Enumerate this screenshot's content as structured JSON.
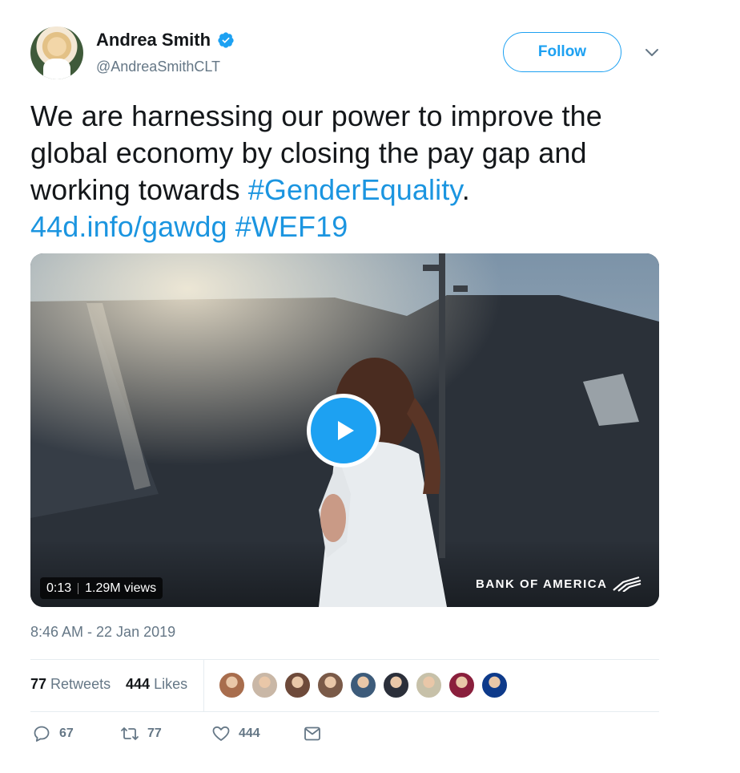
{
  "author": {
    "display_name": "Andrea Smith",
    "handle": "@AndreaSmithCLT"
  },
  "follow_label": "Follow",
  "tweet": {
    "text_plain": "We are harnessing our power to improve the global economy by closing the pay gap and working towards ",
    "hashtag1": "#GenderEquality",
    "period": ".",
    "link": "44d.info/gawdg",
    "hashtag2": "#WEF19"
  },
  "video": {
    "duration": "0:13",
    "views": "1.29M views",
    "brand": "BANK OF AMERICA"
  },
  "timestamp": "8:46 AM - 22 Jan 2019",
  "stats": {
    "retweets_count": "77",
    "retweets_label": "Retweets",
    "likes_count": "444",
    "likes_label": "Likes"
  },
  "likers": [
    {
      "icon": "liker-avatar",
      "color": "#a86d4d"
    },
    {
      "icon": "liker-avatar",
      "color": "#c9b7a6"
    },
    {
      "icon": "liker-avatar",
      "color": "#6e4a3a"
    },
    {
      "icon": "liker-avatar",
      "color": "#7a5a48"
    },
    {
      "icon": "liker-avatar",
      "color": "#3d5b7a"
    },
    {
      "icon": "liker-avatar",
      "color": "#2b2f3a"
    },
    {
      "icon": "liker-avatar",
      "color": "#c7c1a9"
    },
    {
      "icon": "liker-avatar",
      "color": "#8a1f3c"
    },
    {
      "icon": "liker-avatar",
      "color": "#0e3a8a"
    }
  ],
  "actions": {
    "reply_count": "67",
    "retweet_count": "77",
    "like_count": "444"
  },
  "colors": {
    "accent": "#1da1f2",
    "link": "#1b95e0",
    "secondary_text": "#657786"
  }
}
